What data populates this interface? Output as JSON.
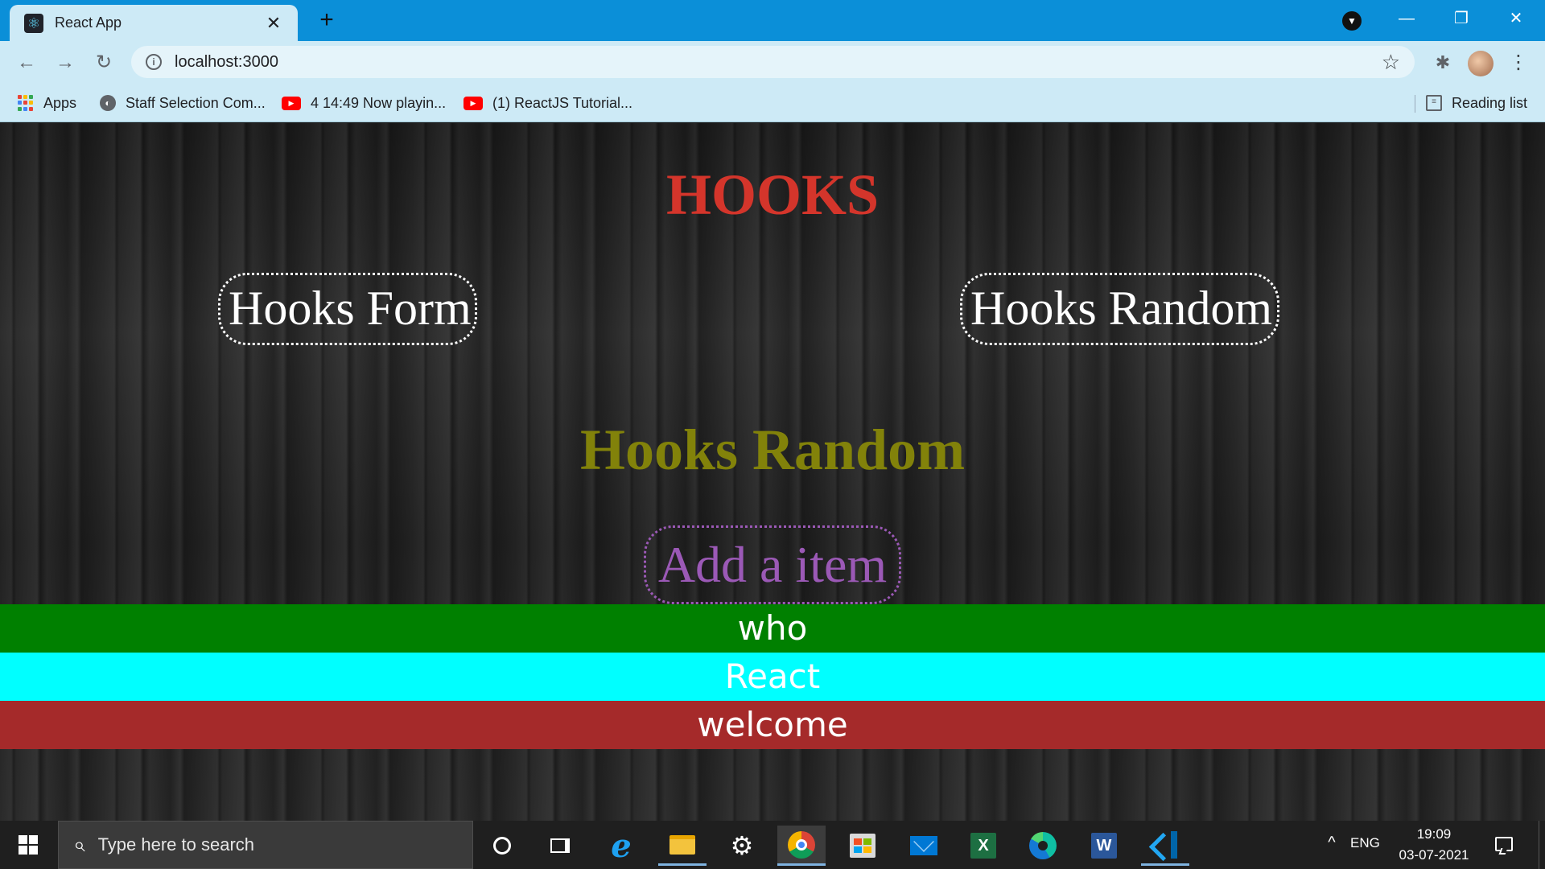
{
  "browser": {
    "tab_title": "React App",
    "tab_icon": "react-icon",
    "tab_close": "✕",
    "new_tab": "+",
    "window_controls": {
      "minimize": "—",
      "restore": "❐",
      "close": "✕"
    },
    "nav": {
      "back": "←",
      "forward": "→",
      "reload": "↻"
    },
    "url": "localhost:3000",
    "star": "☆",
    "extensions": "✱",
    "menu": "⋮",
    "bookmarks": [
      {
        "label": "Apps",
        "icon": "apps-grid-icon"
      },
      {
        "label": "Staff Selection Com...",
        "icon": "globe-icon"
      },
      {
        "label": "4 14:49 Now playin...",
        "icon": "youtube-icon"
      },
      {
        "label": "(1) ReactJS Tutorial...",
        "icon": "youtube-icon"
      }
    ],
    "reading_list": "Reading list"
  },
  "app": {
    "title": "HOOKS",
    "nav_links": [
      "Hooks Form",
      "Hooks Random"
    ],
    "subtitle": "Hooks Random",
    "add_button": "Add a item",
    "items": [
      {
        "text": "who",
        "color": "#008000"
      },
      {
        "text": "React",
        "color": "#00ffff"
      },
      {
        "text": "welcome",
        "color": "#a52a2a"
      }
    ],
    "colors": {
      "title": "#d4352b",
      "subtitle": "#82820a",
      "add_button": "#9b59b6"
    }
  },
  "taskbar": {
    "search_placeholder": "Type here to search",
    "apps": [
      "cortana",
      "task-view",
      "internet-explorer",
      "file-explorer",
      "settings",
      "chrome",
      "microsoft-store",
      "mail",
      "excel",
      "edge",
      "word",
      "vscode"
    ],
    "language": "ENG",
    "time": "19:09",
    "date": "03-07-2021"
  }
}
